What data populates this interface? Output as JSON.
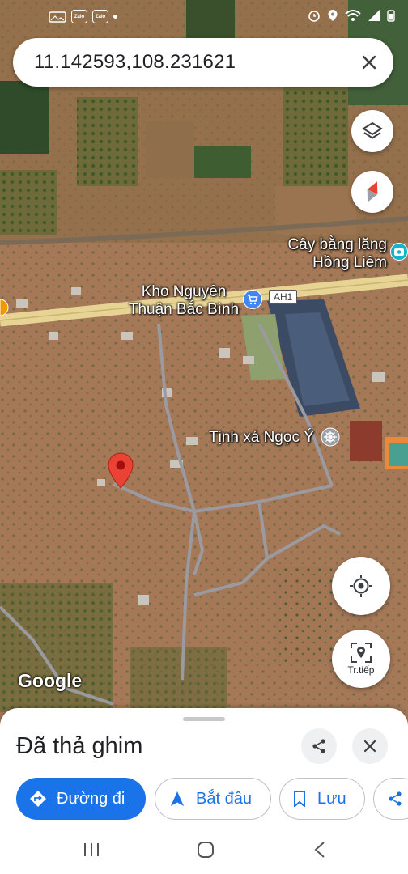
{
  "status_bar": {
    "app_badges": [
      "Zalo",
      "Zalo"
    ]
  },
  "search": {
    "value": "11.142593,108.231621"
  },
  "map": {
    "labels": {
      "poi_memorial": "Cây bằng lăng\nHồng Liêm",
      "poi_store": "Kho Nguyên\nThuận Bắc Bình",
      "road_shield": "AH1",
      "poi_temple": "Tịnh xá Ngọc Ý"
    },
    "attribution": "Google",
    "nav_button_label": "Tr.tiếp"
  },
  "sheet": {
    "title": "Đã thả ghim",
    "actions": {
      "directions": "Đường đi",
      "start": "Bắt đầu",
      "save": "Lưu"
    }
  },
  "colors": {
    "accent": "#1a73e8",
    "pin": "#ea4335",
    "poi_blue": "#4285f4",
    "poi_teal": "#12b5cb"
  }
}
